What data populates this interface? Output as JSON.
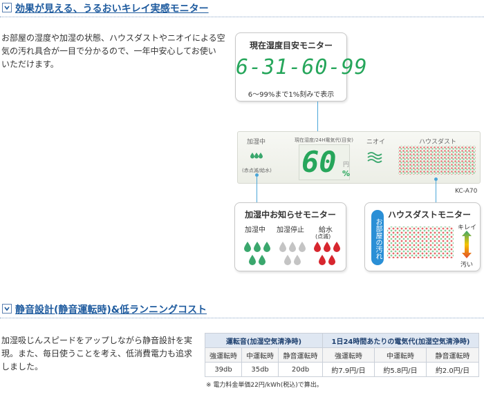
{
  "section1": {
    "title": "効果が見える、うるおいキレイ実感モニター",
    "body": [
      "お部屋の湿度や加湿の状態、ハウスダストやニオイによる空",
      "気の汚れ具合が一目で分かるので、一年中安心してお使い",
      "いただけます。"
    ]
  },
  "humidity_card": {
    "title": "現在湿度目安モニター",
    "readout": "6-31-60-99",
    "note": "6〜99%まで1%刻みで表示"
  },
  "panel": {
    "label_humidifying": "加湿中",
    "label_humidifying_sub": "(赤点滅/給水)",
    "label_current": "現在湿度/24H電気代",
    "label_current_sub": "(目安)",
    "digits": "60",
    "unit_yen": "円",
    "unit_percent": "%",
    "label_odor": "ニオイ",
    "label_dust": "ハウスダスト",
    "model": "KC-A70"
  },
  "humid_card": {
    "title": "加湿中お知らせモニター",
    "states": [
      {
        "label": "加湿中",
        "sub": "",
        "color": "#3aa76d"
      },
      {
        "label": "加湿停止",
        "sub": "",
        "color": "#b9b9b9"
      },
      {
        "label": "給水",
        "sub": "(点滅)",
        "color": "#d7262e"
      }
    ]
  },
  "dust_card": {
    "title": "ハウスダストモニター",
    "side_label": "お部屋の汚れ",
    "clean": "キレイ",
    "dirty": "汚い"
  },
  "section2": {
    "title": "静音設計(静音運転時)&低ランニングコスト",
    "body": [
      "加湿吸じんスピードをアップしながら静音設計を実",
      "現。また、毎日使うことを考え、低消費電力も追求",
      "しました。"
    ]
  },
  "spec_table": {
    "group1": "運転音(加湿空気清浄時)",
    "group2": "1日24時間あたりの電気代(加湿空気清浄時)",
    "sub_headers": [
      "強運転時",
      "中運転時",
      "静音運転時",
      "強運転時",
      "中運転時",
      "静音運転時"
    ],
    "values": [
      "39db",
      "35db",
      "20db",
      "約7.9円/日",
      "約5.8円/日",
      "約2.0円/日"
    ],
    "note": "※ 電力料金単価22円/kWh(税込)で算出。"
  },
  "colors": {
    "accent": "#1d5a9e",
    "lcd_green": "#26a65b",
    "connector": "#4aa6d8"
  }
}
